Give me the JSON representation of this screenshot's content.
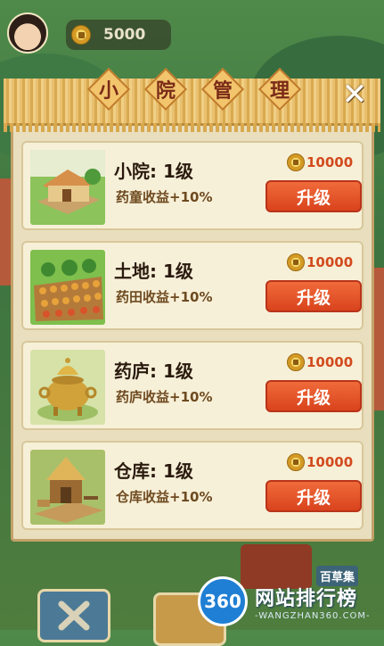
{
  "header": {
    "coin_amount": "5000"
  },
  "dialog": {
    "title_chars": [
      "小",
      "院",
      "管",
      "理"
    ],
    "close_label": "✕",
    "items": [
      {
        "title": "小院: 1级",
        "bonus": "药童收益+10%",
        "cost": "10000",
        "button": "升级",
        "icon": "house-thumbnail"
      },
      {
        "title": "土地: 1级",
        "bonus": "药田收益+10%",
        "cost": "10000",
        "button": "升级",
        "icon": "farmland-thumbnail"
      },
      {
        "title": "药庐: 1级",
        "bonus": "药庐收益+10%",
        "cost": "10000",
        "button": "升级",
        "icon": "cauldron-thumbnail"
      },
      {
        "title": "仓库: 1级",
        "bonus": "仓库收益+10%",
        "cost": "10000",
        "button": "升级",
        "icon": "granary-thumbnail"
      }
    ]
  },
  "bottom": {
    "book_label": "百草集"
  },
  "watermark": {
    "logo": "360",
    "title": "网站排行榜",
    "subtitle": "-WANGZHAN360.COM-"
  },
  "colors": {
    "accent": "#e2532a",
    "panel": "#e9dfbf",
    "card": "#f7f0d8",
    "cost_text": "#d24a1e"
  }
}
